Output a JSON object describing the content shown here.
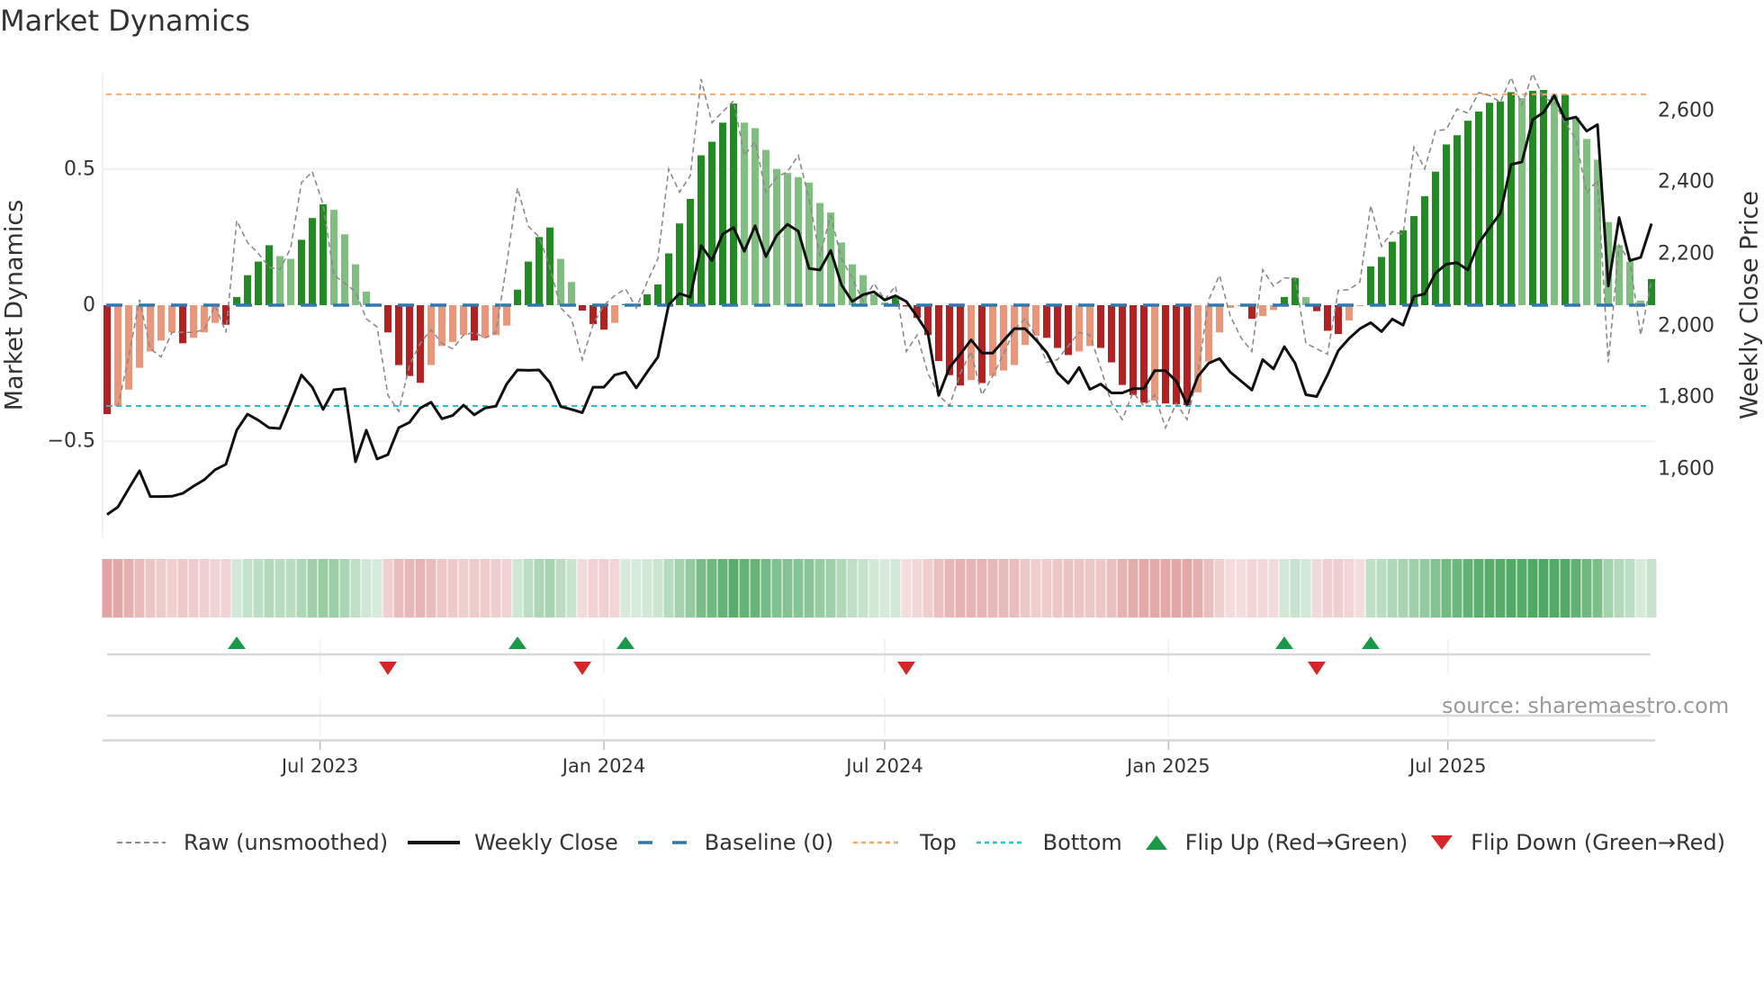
{
  "title": "Market Dynamics",
  "source_label": "source: sharemaestro.com",
  "colors": {
    "bar_up_strong": "#228b22",
    "bar_up_weak": "#80bf80",
    "bar_down_strong": "#b22222",
    "bar_down_weak": "#e9967a",
    "raw": "#8a8a8a",
    "close": "#111111",
    "baseline": "#2f78b0",
    "top": "#f0a868",
    "bottom": "#22c0d6",
    "flip_up": "#1a9a48",
    "flip_down": "#d62728"
  },
  "legend": [
    {
      "key": "raw",
      "label": "Raw (unsmoothed)"
    },
    {
      "key": "close",
      "label": "Weekly Close"
    },
    {
      "key": "baseline",
      "label": "Baseline (0)"
    },
    {
      "key": "top",
      "label": "Top"
    },
    {
      "key": "bottom",
      "label": "Bottom"
    },
    {
      "key": "flip_up",
      "label": "Flip Up (Red→Green)"
    },
    {
      "key": "flip_down",
      "label": "Flip Down (Green→Red)"
    }
  ],
  "chart_data": {
    "type": "bar",
    "title": "Market Dynamics",
    "xlabel": "",
    "ylabel": "Market Dynamics",
    "y2label": "Weekly Close Price",
    "x_start_week": "2023-02-13",
    "x_step_days": 7,
    "ylim": [
      -0.72,
      0.86
    ],
    "y2lim": [
      1430,
      2730
    ],
    "yticks": [
      {
        "v": 0.5,
        "label": "0.5"
      },
      {
        "v": 0,
        "label": "0"
      },
      {
        "v": -0.5,
        "label": "−0.5"
      }
    ],
    "y2ticks": [
      {
        "v": 1600,
        "label": "1,600"
      },
      {
        "v": 1800,
        "label": "1,800"
      },
      {
        "v": 2000,
        "label": "2,000"
      },
      {
        "v": 2200,
        "label": "2,200"
      },
      {
        "v": 2400,
        "label": "2,400"
      },
      {
        "v": 2600,
        "label": "2,600"
      }
    ],
    "xticks": [
      {
        "date": "2023-07-01",
        "label": "Jul 2023"
      },
      {
        "date": "2024-01-01",
        "label": "Jan 2024"
      },
      {
        "date": "2024-07-01",
        "label": "Jul 2024"
      },
      {
        "date": "2025-01-01",
        "label": "Jan 2025"
      },
      {
        "date": "2025-07-01",
        "label": "Jul 2025"
      }
    ],
    "top_level": 0.774,
    "bottom_level": -0.37,
    "baseline": 0,
    "grid": true,
    "legend_position": "bottom",
    "series": [
      {
        "name": "Market Dynamics",
        "kind": "bar",
        "values": [
          -0.4,
          -0.37,
          -0.31,
          -0.23,
          -0.17,
          -0.13,
          -0.1,
          -0.14,
          -0.12,
          -0.1,
          -0.065,
          -0.072,
          0.03,
          0.11,
          0.16,
          0.22,
          0.18,
          0.17,
          0.24,
          0.32,
          0.37,
          0.35,
          0.26,
          0.15,
          0.05,
          0.003,
          -0.1,
          -0.22,
          -0.26,
          -0.285,
          -0.22,
          -0.15,
          -0.135,
          -0.11,
          -0.13,
          -0.12,
          -0.11,
          -0.075,
          0.057,
          0.16,
          0.25,
          0.285,
          0.17,
          0.085,
          -0.02,
          -0.07,
          -0.09,
          -0.065,
          0.004,
          0.003,
          0.04,
          0.076,
          0.19,
          0.3,
          0.39,
          0.55,
          0.6,
          0.67,
          0.74,
          0.67,
          0.65,
          0.57,
          0.5,
          0.485,
          0.47,
          0.45,
          0.375,
          0.34,
          0.23,
          0.15,
          0.11,
          0.04,
          0.01,
          0.035,
          -0.005,
          -0.047,
          -0.11,
          -0.205,
          -0.257,
          -0.295,
          -0.275,
          -0.286,
          -0.26,
          -0.24,
          -0.22,
          -0.146,
          -0.113,
          -0.12,
          -0.157,
          -0.183,
          -0.17,
          -0.15,
          -0.157,
          -0.21,
          -0.293,
          -0.33,
          -0.358,
          -0.35,
          -0.361,
          -0.364,
          -0.367,
          -0.32,
          -0.207,
          -0.1,
          -0.01,
          -0.004,
          -0.05,
          -0.04,
          -0.018,
          0.03,
          0.1,
          0.03,
          -0.022,
          -0.094,
          -0.106,
          -0.056,
          -0.003,
          0.142,
          0.177,
          0.233,
          0.275,
          0.327,
          0.4,
          0.49,
          0.59,
          0.624,
          0.677,
          0.711,
          0.743,
          0.748,
          0.782,
          0.76,
          0.787,
          0.79,
          0.77,
          0.772,
          0.69,
          0.61,
          0.534,
          0.305,
          0.22,
          0.16,
          0.017,
          0.096
        ]
      },
      {
        "name": "Raw (unsmoothed)",
        "kind": "line",
        "values": [
          -0.37,
          -0.37,
          -0.19,
          0.02,
          -0.16,
          -0.19,
          -0.1,
          -0.1,
          -0.1,
          -0.09,
          0,
          -0.1,
          0.31,
          0.23,
          0.19,
          0.14,
          0.13,
          0.21,
          0.45,
          0.49,
          0.37,
          0.11,
          0.08,
          0.05,
          -0.05,
          -0.08,
          -0.33,
          -0.39,
          -0.22,
          -0.14,
          -0.09,
          -0.14,
          -0.16,
          -0.11,
          -0.1,
          -0.12,
          -0.1,
          0.15,
          0.43,
          0.29,
          0.25,
          0.14,
          -0.01,
          -0.05,
          -0.2,
          -0.07,
          0,
          0.035,
          0.06,
          -0.01,
          0.085,
          0.17,
          0.5,
          0.415,
          0.475,
          0.83,
          0.67,
          0.71,
          0.75,
          0.55,
          0.6,
          0.415,
          0.47,
          0.49,
          0.55,
          0.39,
          0.18,
          0.33,
          0.17,
          0.1,
          0.013,
          0.08,
          0.02,
          0.07,
          -0.17,
          -0.11,
          -0.25,
          -0.33,
          -0.37,
          -0.25,
          -0.17,
          -0.33,
          -0.26,
          -0.18,
          -0.09,
          -0.05,
          -0.11,
          -0.21,
          -0.2,
          -0.15,
          -0.1,
          -0.11,
          -0.23,
          -0.36,
          -0.42,
          -0.32,
          -0.37,
          -0.33,
          -0.45,
          -0.36,
          -0.42,
          -0.25,
          0.02,
          0.11,
          -0.04,
          -0.12,
          -0.17,
          0.13,
          0.07,
          0.1,
          0.1,
          -0.14,
          -0.16,
          -0.18,
          0.054,
          0.057,
          0.085,
          0.366,
          0.216,
          0.27,
          0.26,
          0.58,
          0.5,
          0.64,
          0.645,
          0.72,
          0.705,
          0.78,
          0.77,
          0.745,
          0.836,
          0.735,
          0.85,
          0.76,
          0.745,
          0.67,
          0.61,
          0.41,
          0.46,
          -0.21,
          0.22,
          0.16,
          -0.11,
          0.09
        ]
      },
      {
        "name": "Weekly Close",
        "kind": "line",
        "axis": "y2",
        "values": [
          1473,
          1494,
          1545,
          1595,
          1523,
          1523,
          1524,
          1532,
          1552,
          1570,
          1598,
          1613,
          1708,
          1753,
          1736,
          1715,
          1713,
          1786,
          1862,
          1828,
          1766,
          1821,
          1824,
          1620,
          1708,
          1628,
          1640,
          1715,
          1730,
          1770,
          1786,
          1740,
          1749,
          1778,
          1751,
          1770,
          1775,
          1837,
          1876,
          1875,
          1876,
          1841,
          1774,
          1766,
          1757,
          1828,
          1828,
          1862,
          1870,
          1826,
          1870,
          1912,
          2058,
          2089,
          2079,
          2223,
          2181,
          2255,
          2273,
          2207,
          2278,
          2192,
          2251,
          2282,
          2263,
          2159,
          2155,
          2209,
          2113,
          2067,
          2086,
          2094,
          2071,
          2083,
          2067,
          2025,
          1979,
          1805,
          1883,
          1920,
          1960,
          1923,
          1923,
          1958,
          1991,
          1991,
          1960,
          1925,
          1868,
          1839,
          1883,
          1822,
          1837,
          1812,
          1812,
          1824,
          1824,
          1874,
          1874,
          1845,
          1780,
          1858,
          1895,
          1908,
          1870,
          1845,
          1820,
          1905,
          1879,
          1941,
          1895,
          1807,
          1802,
          1862,
          1930,
          1964,
          1991,
          2008,
          1983,
          2018,
          2001,
          2081,
          2088,
          2146,
          2171,
          2175,
          2155,
          2230,
          2272,
          2313,
          2449,
          2456,
          2574,
          2594,
          2641,
          2574,
          2581,
          2542,
          2560,
          2110,
          2301,
          2181,
          2190,
          2284
        ]
      }
    ],
    "flips": [
      {
        "date": "2023-05-08",
        "dir": "up"
      },
      {
        "date": "2023-08-14",
        "dir": "down"
      },
      {
        "date": "2023-11-06",
        "dir": "up"
      },
      {
        "date": "2023-12-18",
        "dir": "down"
      },
      {
        "date": "2024-01-15",
        "dir": "up"
      },
      {
        "date": "2024-07-15",
        "dir": "down"
      },
      {
        "date": "2025-03-17",
        "dir": "up"
      },
      {
        "date": "2025-04-07",
        "dir": "down"
      },
      {
        "date": "2025-05-12",
        "dir": "up"
      }
    ]
  }
}
